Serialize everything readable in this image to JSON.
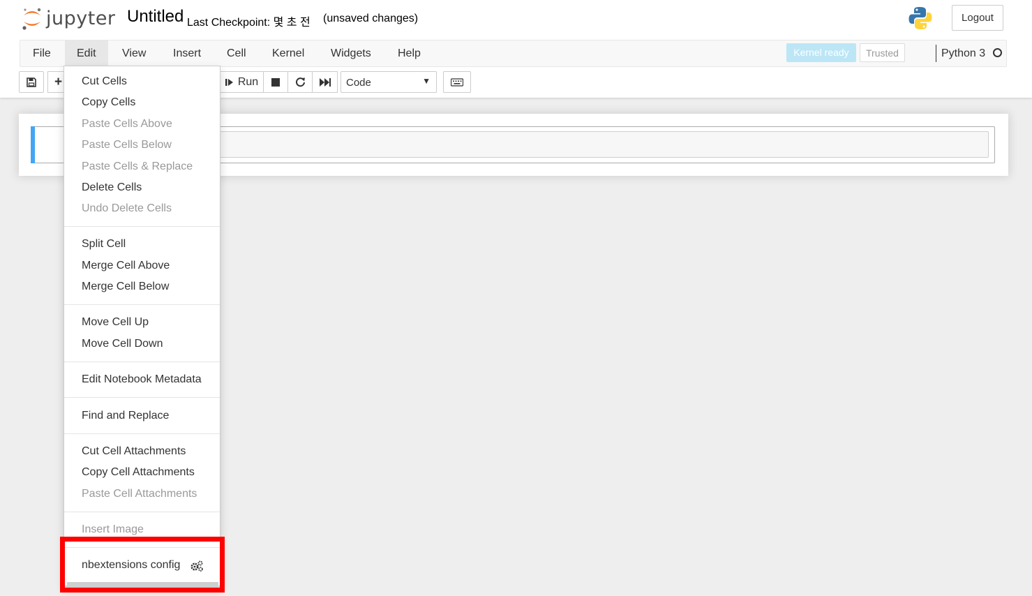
{
  "header": {
    "logo_text": "jupyter",
    "notebook_title": "Untitled",
    "checkpoint": "Last Checkpoint: 몇 초 전",
    "autosave_status": "(unsaved changes)",
    "logout_label": "Logout"
  },
  "menubar": {
    "menus": [
      "File",
      "Edit",
      "View",
      "Insert",
      "Cell",
      "Kernel",
      "Widgets",
      "Help"
    ],
    "kernel_ready": "Kernel ready",
    "trusted": "Trusted",
    "kernel_name": "Python 3"
  },
  "toolbar": {
    "run_label": "Run",
    "cell_type": "Code"
  },
  "edit_menu": {
    "items": [
      {
        "label": "Cut Cells",
        "enabled": true
      },
      {
        "label": "Copy Cells",
        "enabled": true
      },
      {
        "label": "Paste Cells Above",
        "enabled": false
      },
      {
        "label": "Paste Cells Below",
        "enabled": false
      },
      {
        "label": "Paste Cells & Replace",
        "enabled": false
      },
      {
        "label": "Delete Cells",
        "enabled": true
      },
      {
        "label": "Undo Delete Cells",
        "enabled": false
      },
      {
        "label": "Split Cell",
        "enabled": true
      },
      {
        "label": "Merge Cell Above",
        "enabled": true
      },
      {
        "label": "Merge Cell Below",
        "enabled": true
      },
      {
        "label": "Move Cell Up",
        "enabled": true
      },
      {
        "label": "Move Cell Down",
        "enabled": true
      },
      {
        "label": "Edit Notebook Metadata",
        "enabled": true
      },
      {
        "label": "Find and Replace",
        "enabled": true
      },
      {
        "label": "Cut Cell Attachments",
        "enabled": true
      },
      {
        "label": "Copy Cell Attachments",
        "enabled": true
      },
      {
        "label": "Paste Cell Attachments",
        "enabled": false
      },
      {
        "label": "Insert Image",
        "enabled": false
      },
      {
        "label": "nbextensions config",
        "enabled": true,
        "icon": "gears-icon"
      }
    ],
    "highlighted_item": "nbextensions config"
  },
  "colors": {
    "cell_selected_bar": "#42a5f5",
    "kernel_ready_bg": "#bce6f6",
    "highlight_box": "#ff0000",
    "jupyter_orange": "#f37726"
  }
}
